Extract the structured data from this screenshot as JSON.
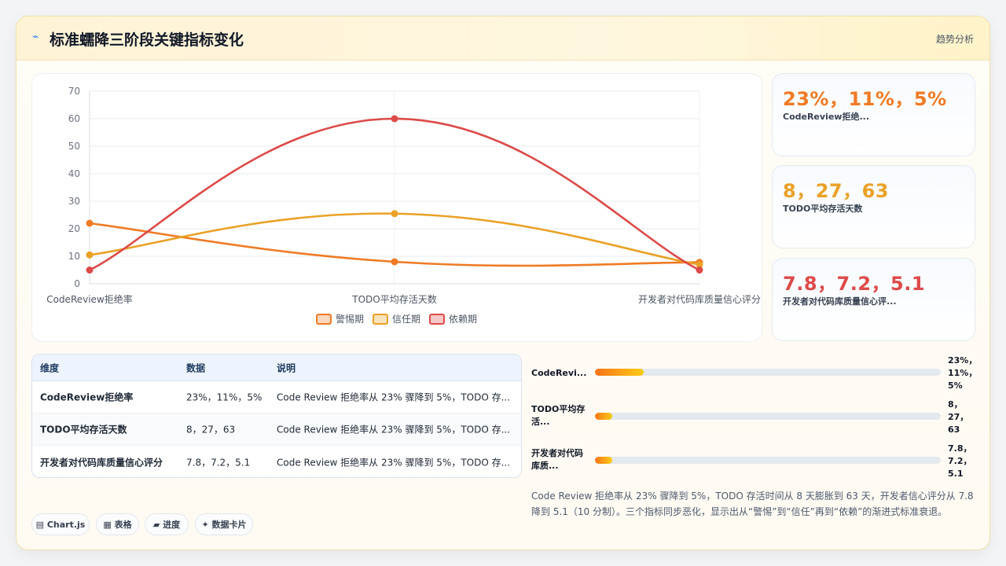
{
  "header": {
    "icon": "sparkle-icon",
    "title": "标准蠕降三阶段关键指标变化",
    "tag": "趋势分析"
  },
  "chart_data": {
    "type": "line",
    "categories": [
      "CodeReview拒绝率",
      "TODO平均存活天数",
      "开发者对代码库质量信心评分"
    ],
    "series": [
      {
        "name": "警惕期",
        "values": [
          22,
          8,
          7.8
        ],
        "color": "#f07a23"
      },
      {
        "name": "信任期",
        "values": [
          10.5,
          25.5,
          7
        ],
        "color": "#eaa126"
      },
      {
        "name": "依赖期",
        "values": [
          5,
          60,
          5
        ],
        "color": "#dc4a48"
      }
    ],
    "ylim": [
      0,
      70
    ],
    "yticks": [
      "0",
      "10",
      "20",
      "30",
      "40",
      "50",
      "60",
      "70"
    ],
    "grid": true,
    "legend": "bottom"
  },
  "stats": [
    {
      "value": "23%，11%，5%",
      "label": "CodeReview拒绝...",
      "color": "#f07a23"
    },
    {
      "value": "8，27，63",
      "label": "TODO平均存活天数",
      "color": "#eaa126"
    },
    {
      "value": "7.8，7.2，5.1",
      "label": "开发者对代码库质量信心评...",
      "color": "#dc4a48"
    }
  ],
  "table": {
    "headers": [
      "维度",
      "数据",
      "说明"
    ],
    "rows": [
      [
        "CodeReview拒绝率",
        "23%，11%，5%",
        "Code Review 拒绝率从 23% 骤降到 5%，TODO 存..."
      ],
      [
        "TODO平均存活天数",
        "8，27，63",
        "Code Review 拒绝率从 23% 骤降到 5%，TODO 存..."
      ],
      [
        "开发者对代码库质量信心评分",
        "7.8，7.2，5.1",
        "Code Review 拒绝率从 23% 骤降到 5%，TODO 存..."
      ]
    ]
  },
  "progress": [
    {
      "label": "CodeRevi...",
      "value": "23%，11%，5%",
      "fill": 0.14
    },
    {
      "label": "TODO平均存活...",
      "value": "8，27，63",
      "fill": 0.05
    },
    {
      "label": "开发者对代码库质...",
      "value": "7.8，7.2，5.1",
      "fill": 0.05
    }
  ],
  "summary": "Code Review 拒绝率从 23% 骤降到 5%，TODO 存活时间从 8 天膨胀到 63 天，开发者信心评分从 7.8 降到 5.1（10 分制）。三个指标同步恶化，显示出从“警惕”到“信任”再到“依赖”的渐进式标准衰退。",
  "chips": [
    "▤ Chart.js",
    "▦ 表格",
    "▰ 进度",
    "✦ 数据卡片"
  ]
}
